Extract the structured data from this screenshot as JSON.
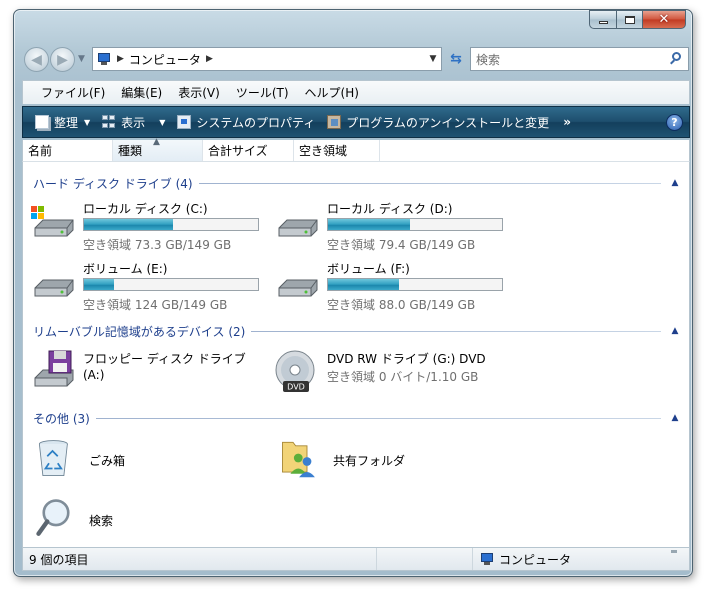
{
  "window": {
    "caption_buttons": {
      "minimize": "minimize",
      "maximize": "maximize",
      "close": "✕"
    }
  },
  "address": {
    "crumb": "コンピュータ",
    "search_placeholder": "検索"
  },
  "menubar": [
    "ファイル(F)",
    "編集(E)",
    "表示(V)",
    "ツール(T)",
    "ヘルプ(H)"
  ],
  "command_bar": {
    "organize": "整理",
    "views": "表示",
    "system_properties": "システムのプロパティ",
    "programs": "プログラムのアンインストールと変更",
    "more": "»",
    "help": "?"
  },
  "columns": [
    "名前",
    "種類",
    "合計サイズ",
    "空き領域"
  ],
  "groups": {
    "hdd": {
      "title": "ハード ディスク ドライブ (4)",
      "drives": [
        {
          "name": "ローカル ディスク (C:)",
          "free_text": "空き領域 73.3 GB/149 GB",
          "used_fraction": 0.51
        },
        {
          "name": "ローカル ディスク (D:)",
          "free_text": "空き領域 79.4 GB/149 GB",
          "used_fraction": 0.47
        },
        {
          "name": "ボリューム (E:)",
          "free_text": "空き領域 124 GB/149 GB",
          "used_fraction": 0.17
        },
        {
          "name": "ボリューム (F:)",
          "free_text": "空き領域 88.0 GB/149 GB",
          "used_fraction": 0.41
        }
      ]
    },
    "removable": {
      "title": "リムーバブル記憶域があるデバイス (2)",
      "floppy": {
        "line1": "フロッピー ディスク ドライブ",
        "line2": "(A:)"
      },
      "dvd": {
        "name": "DVD RW ドライブ (G:) DVD",
        "free_text": "空き領域 0 バイト/1.10 GB",
        "badge": "DVD"
      }
    },
    "other": {
      "title": "その他 (3)",
      "items": {
        "recycle": "ごみ箱",
        "shared": "共有フォルダ",
        "search": "検索"
      }
    }
  },
  "status": {
    "count": "9 個の項目",
    "location": "コンピュータ"
  },
  "colors": {
    "command_bar": "#1e4f6e",
    "group_header": "#1e3f8c",
    "bar_fill": "#2f9ec0"
  }
}
